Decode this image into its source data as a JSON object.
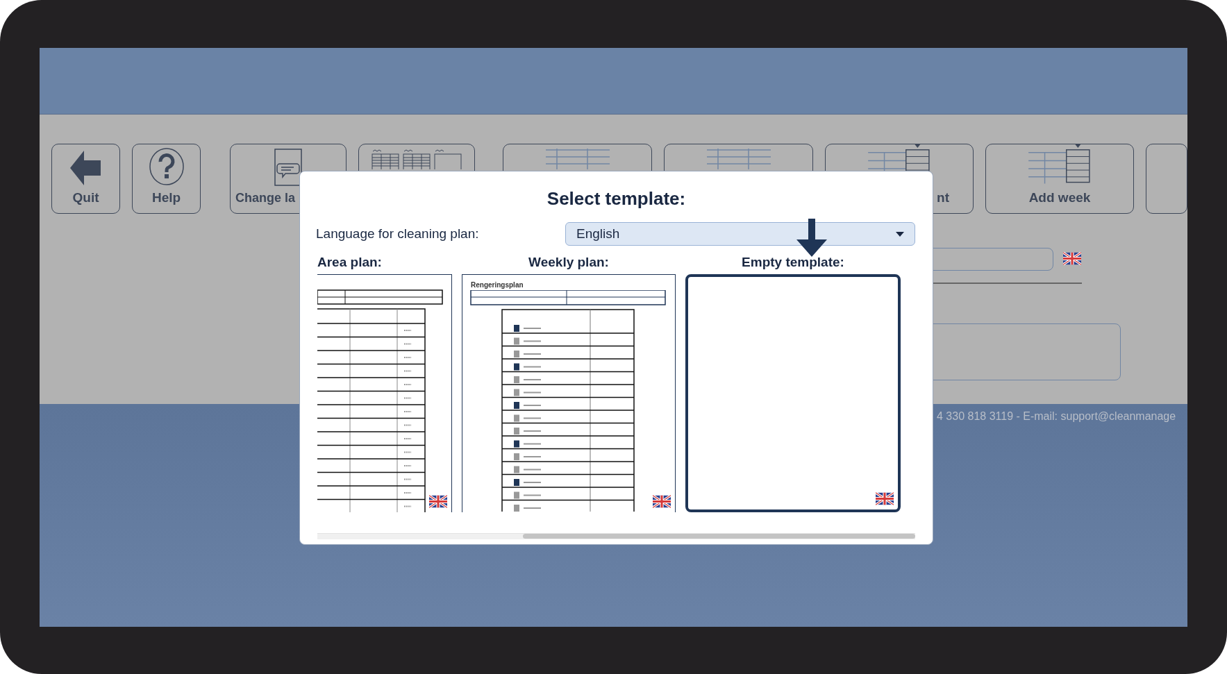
{
  "toolbar": [
    {
      "kind": "quit",
      "label": "Quit"
    },
    {
      "kind": "help",
      "label": "Help"
    },
    {
      "kind": "language",
      "label": "Change la"
    },
    {
      "kind": "plans"
    },
    {
      "kind": "table"
    },
    {
      "kind": "table"
    },
    {
      "kind": "week",
      "label": "nt",
      "cut": true
    },
    {
      "kind": "week",
      "label": "Add week"
    },
    {
      "kind": "partial"
    }
  ],
  "dialog": {
    "title": "Select template:",
    "language_label": "Language for cleaning plan:",
    "language": {
      "value": "English"
    },
    "templates": [
      {
        "kind": "area",
        "title": "Area plan:",
        "selected": false
      },
      {
        "kind": "weekly",
        "title": "Weekly plan:",
        "heading": "Rengeringsplan",
        "selected": false
      },
      {
        "kind": "empty",
        "title": "Empty template:",
        "selected": true
      }
    ]
  },
  "footer": "4 330 818 3119 - E-mail: support@cleanmanage"
}
